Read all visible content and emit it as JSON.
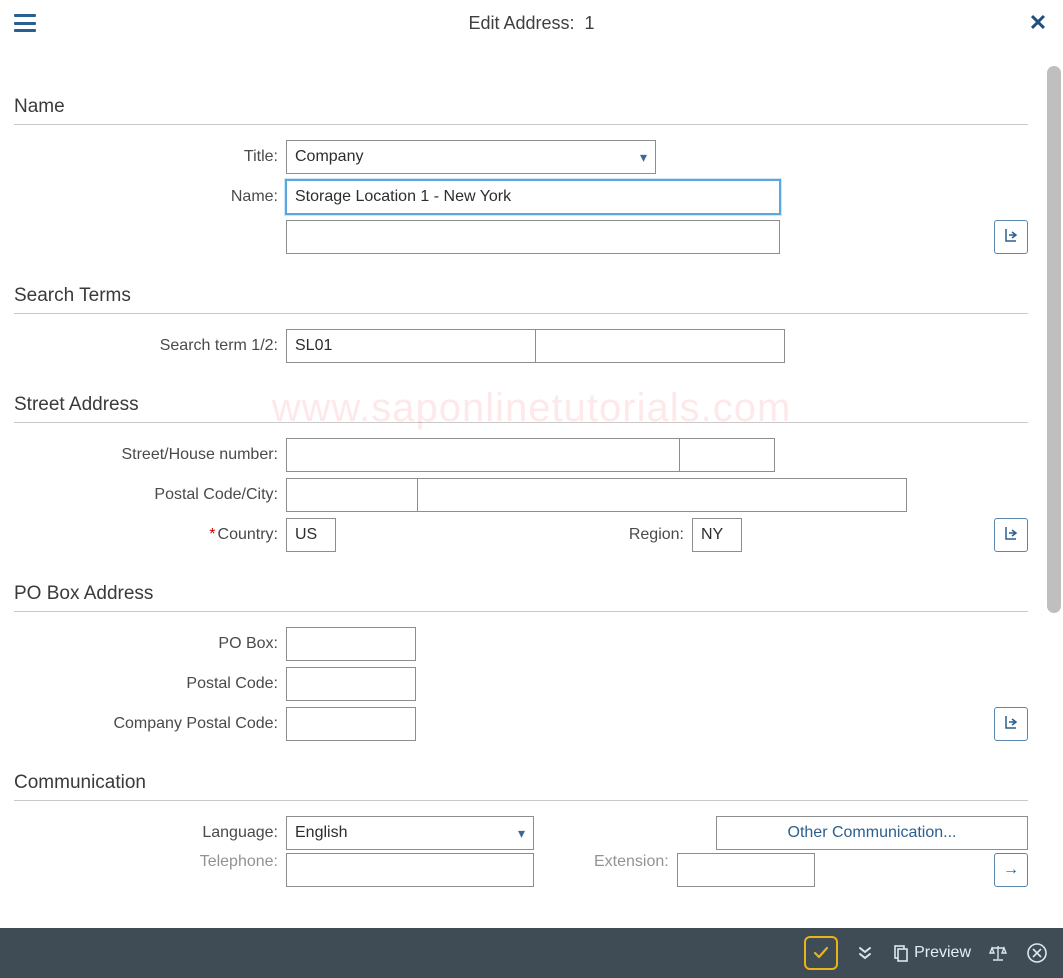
{
  "header": {
    "title_label": "Edit Address:",
    "title_number": "1"
  },
  "watermark": "www.saponlinetutorials.com",
  "sections": {
    "name": {
      "header": "Name",
      "title_label": "Title:",
      "title_value": "Company",
      "name_label": "Name:",
      "name_value": "Storage Location 1 - New York",
      "name2_value": ""
    },
    "search": {
      "header": "Search Terms",
      "term_label": "Search term 1/2:",
      "term1_value": "SL01",
      "term2_value": ""
    },
    "street": {
      "header": "Street Address",
      "street_label": "Street/House number:",
      "street_value": "",
      "house_value": "",
      "postal_label": "Postal Code/City:",
      "postal_value": "",
      "city_value": "",
      "country_label": "Country:",
      "country_value": "US",
      "region_label": "Region:",
      "region_value": "NY"
    },
    "pobox": {
      "header": "PO Box Address",
      "box_label": "PO Box:",
      "box_value": "",
      "postal_label": "Postal Code:",
      "postal_value": "",
      "company_postal_label": "Company Postal Code:",
      "company_postal_value": ""
    },
    "comm": {
      "header": "Communication",
      "language_label": "Language:",
      "language_value": "English",
      "other_button": "Other Communication...",
      "telephone_label": "Telephone:",
      "ext_label": "Extension:"
    }
  },
  "footer": {
    "preview_label": "Preview"
  }
}
